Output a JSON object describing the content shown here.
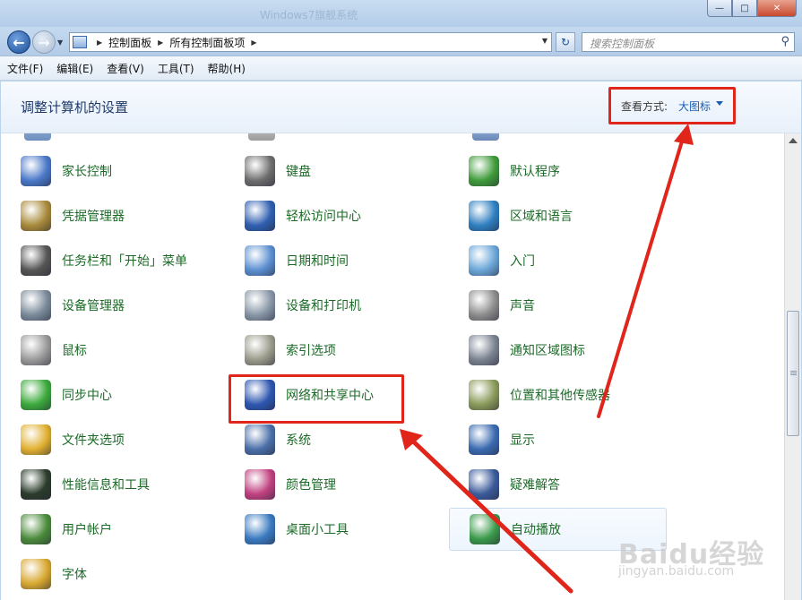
{
  "window": {
    "title": "Windows7旗舰系统",
    "buttons": [
      "—",
      "□",
      "✕"
    ]
  },
  "nav": {
    "breadcrumbs": [
      "控制面板",
      "所有控制面板项"
    ],
    "search_placeholder": "搜索控制面板"
  },
  "menu": [
    "文件(F)",
    "编辑(E)",
    "查看(V)",
    "工具(T)",
    "帮助(H)"
  ],
  "header": {
    "title": "调整计算机的设置",
    "view_label": "查看方式:",
    "view_value": "大图标"
  },
  "items": [
    {
      "label": "家长控制",
      "icon": "parental-controls-icon",
      "color": "#4a78c8"
    },
    {
      "label": "键盘",
      "icon": "keyboard-icon",
      "color": "#6d6d6d"
    },
    {
      "label": "默认程序",
      "icon": "default-programs-icon",
      "color": "#3f9b3a"
    },
    {
      "label": "凭据管理器",
      "icon": "credential-manager-icon",
      "color": "#a88a3a"
    },
    {
      "label": "轻松访问中心",
      "icon": "ease-of-access-icon",
      "color": "#2f5fb0"
    },
    {
      "label": "区域和语言",
      "icon": "region-language-icon",
      "color": "#2f7fc0"
    },
    {
      "label": "任务栏和「开始」菜单",
      "icon": "taskbar-icon",
      "color": "#555555"
    },
    {
      "label": "日期和时间",
      "icon": "date-time-icon",
      "color": "#5b8fd0"
    },
    {
      "label": "入门",
      "icon": "getting-started-icon",
      "color": "#6aa6d8"
    },
    {
      "label": "设备管理器",
      "icon": "device-manager-icon",
      "color": "#7a8a9a"
    },
    {
      "label": "设备和打印机",
      "icon": "devices-printers-icon",
      "color": "#8796a6"
    },
    {
      "label": "声音",
      "icon": "sound-icon",
      "color": "#8c8c8c"
    },
    {
      "label": "鼠标",
      "icon": "mouse-icon",
      "color": "#9a9a9a"
    },
    {
      "label": "索引选项",
      "icon": "indexing-options-icon",
      "color": "#9a9a8a"
    },
    {
      "label": "通知区域图标",
      "icon": "notification-area-icon",
      "color": "#7a8290"
    },
    {
      "label": "同步中心",
      "icon": "sync-center-icon",
      "color": "#3caa3c"
    },
    {
      "label": "网络和共享中心",
      "icon": "network-sharing-icon",
      "color": "#2d56b0"
    },
    {
      "label": "位置和其他传感器",
      "icon": "location-sensors-icon",
      "color": "#8a9a5a"
    },
    {
      "label": "文件夹选项",
      "icon": "folder-options-icon",
      "color": "#e0b030"
    },
    {
      "label": "系统",
      "icon": "system-icon",
      "color": "#4a6fa8"
    },
    {
      "label": "显示",
      "icon": "display-icon",
      "color": "#3a6ab0"
    },
    {
      "label": "性能信息和工具",
      "icon": "performance-icon",
      "color": "#2b3b2b"
    },
    {
      "label": "颜色管理",
      "icon": "color-management-icon",
      "color": "#c04080"
    },
    {
      "label": "疑难解答",
      "icon": "troubleshooting-icon",
      "color": "#3a5a9a"
    },
    {
      "label": "用户帐户",
      "icon": "user-accounts-icon",
      "color": "#4b8b3b"
    },
    {
      "label": "桌面小工具",
      "icon": "desktop-gadgets-icon",
      "color": "#3a7ac0"
    },
    {
      "label": "自动播放",
      "icon": "autoplay-icon",
      "color": "#3a9a4a"
    },
    {
      "label": "字体",
      "icon": "fonts-icon",
      "color": "#d8a830"
    }
  ],
  "watermark": {
    "logo": "Baidu经验",
    "url": "jingyan.baidu.com"
  },
  "annotation_color": "#e0251b"
}
